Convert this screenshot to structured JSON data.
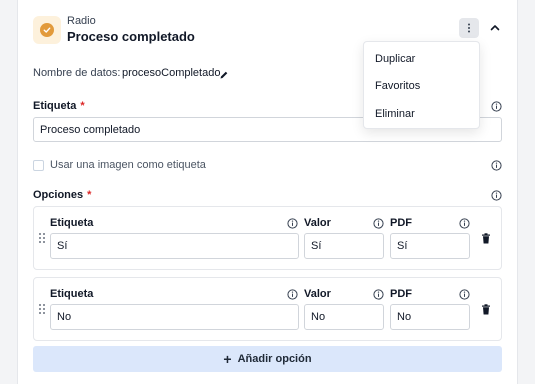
{
  "header": {
    "type_label": "Radio",
    "title": "Proceso completado"
  },
  "data_name": {
    "label": "Nombre de datos:",
    "value": "procesoCompletado"
  },
  "label_field": {
    "label": "Etiqueta",
    "required_mark": "*",
    "value": "Proceso completado"
  },
  "image_label_checkbox": {
    "label": "Usar una imagen como etiqueta",
    "checked": false
  },
  "options": {
    "label": "Opciones",
    "required_mark": "*",
    "columns": {
      "label": "Etiqueta",
      "value": "Valor",
      "pdf": "PDF"
    },
    "rows": [
      {
        "label": "Sí",
        "value": "Sí",
        "pdf": "Sí"
      },
      {
        "label": "No",
        "value": "No",
        "pdf": "No"
      }
    ],
    "add_button": "Añadir opción",
    "add_icon": "+"
  },
  "menu": {
    "items": [
      "Duplicar",
      "Favoritos",
      "Eliminar"
    ]
  },
  "colors": {
    "accent_icon": "#e29a3b",
    "add_button_bg": "#dbe7fb",
    "required": "#dc2626"
  }
}
